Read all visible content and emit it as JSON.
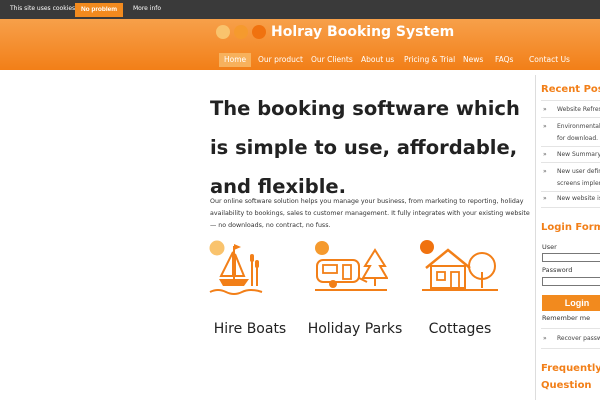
{
  "cookie_bar": {
    "message": "This site uses cookies",
    "accept_label": "No problem",
    "more_info_label": "More info"
  },
  "header": {
    "title": "Holray Booking System",
    "nav": [
      {
        "label": "Home",
        "active": true
      },
      {
        "label": "Our product"
      },
      {
        "label": "Our Clients"
      },
      {
        "label": "About us"
      },
      {
        "label": "Pricing & Trial"
      },
      {
        "label": "News"
      },
      {
        "label": "FAQs"
      },
      {
        "label": "Contact Us"
      }
    ]
  },
  "main": {
    "headline": "The booking software which is simple to use, affordable, and flexible.",
    "intro": "Our online software solution helps you manage your business, from marketing to reporting, holiday availability to bookings, sales to customer management. It fully integrates with your existing website — no downloads, no contract, no fuss.",
    "features": [
      {
        "label": "Hire Boats",
        "icon": "boat-icon"
      },
      {
        "label": "Holiday Parks",
        "icon": "caravan-icon"
      },
      {
        "label": "Cottages",
        "icon": "cottage-icon"
      }
    ]
  },
  "sidebar": {
    "recent_posts_heading": "Recent Posts",
    "posts": [
      [
        "Website Refresh"
      ],
      [
        "Environmental …",
        "for download."
      ],
      [
        "New Summary …"
      ],
      [
        "New user defin…",
        "screens implem…"
      ],
      [
        "New website is …"
      ]
    ],
    "login_heading": "Login Form",
    "user_label": "User",
    "password_label": "Password",
    "login_button": "Login",
    "remember_label": "Remember me",
    "recover_label": "Recover password",
    "faq_heading_line1": "Frequently Asked",
    "faq_heading_line2": "Question"
  },
  "colors": {
    "accent": "#f27f18",
    "cookie_bar": "#3a3a3a",
    "dot_light": "#f9c36d",
    "dot_mid": "#f59a2e",
    "dot_dark": "#f0720f"
  }
}
